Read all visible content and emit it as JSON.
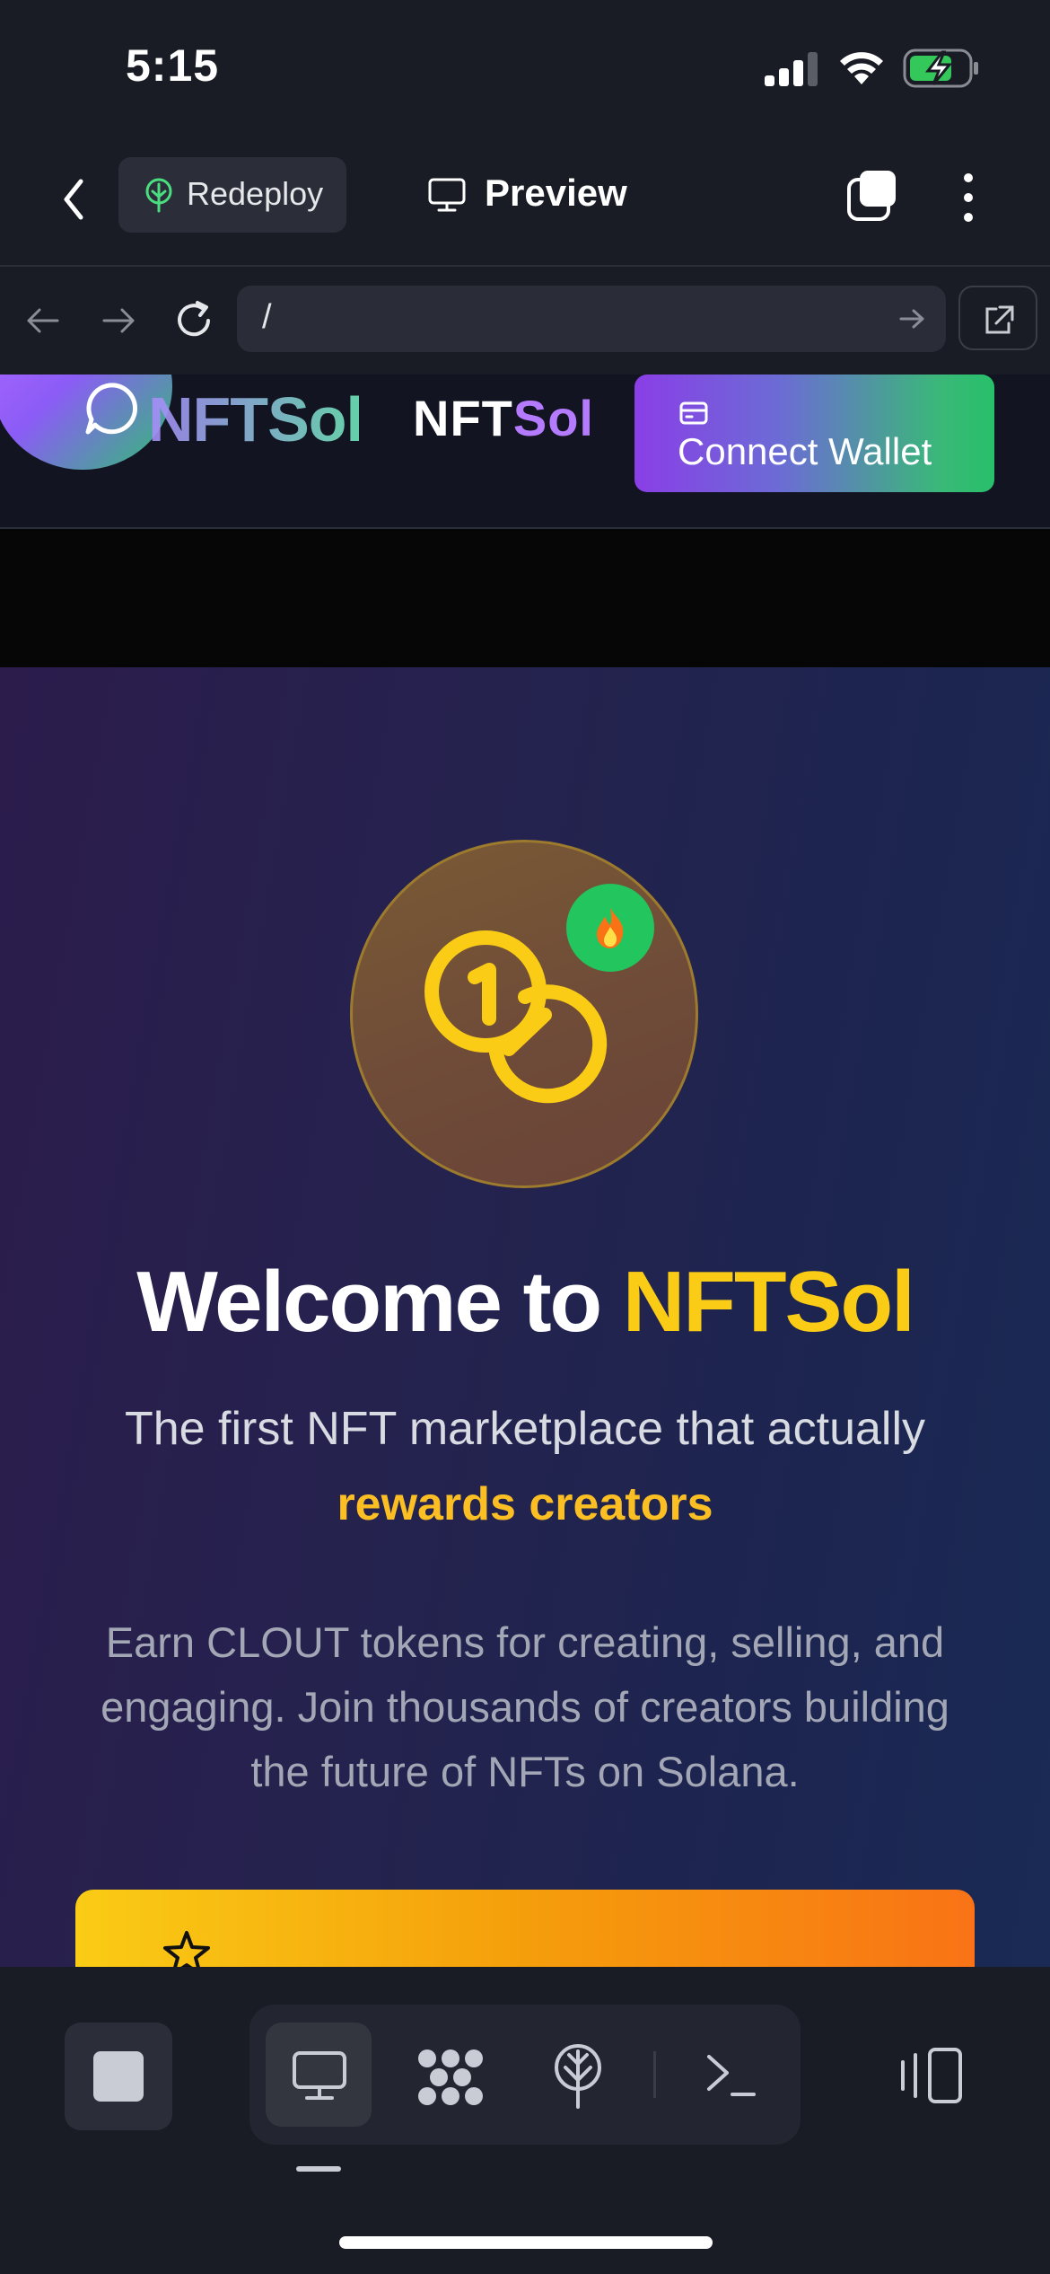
{
  "status": {
    "time": "5:15"
  },
  "toolbar": {
    "redeploy_label": "Redeploy",
    "preview_label": "Preview"
  },
  "browser": {
    "url": "/"
  },
  "site": {
    "logo_faded": "NFTSol",
    "logo_nft": "NFT",
    "logo_sol": "Sol",
    "connect_wallet_label": "Connect Wallet"
  },
  "hero": {
    "badge_icon": "fire-icon",
    "title_prefix": "Welcome to ",
    "title_brand": "NFTSol",
    "subtitle_line": "The first NFT marketplace that actually",
    "subtitle_highlight": "rewards creators",
    "description": "Earn CLOUT tokens for creating, selling, and engaging. Join thousands of creators building the future of NFTs on Solana."
  },
  "colors": {
    "accent_yellow": "#facc15",
    "brand_purple": "#7c3aed",
    "brand_green": "#22c55e"
  }
}
